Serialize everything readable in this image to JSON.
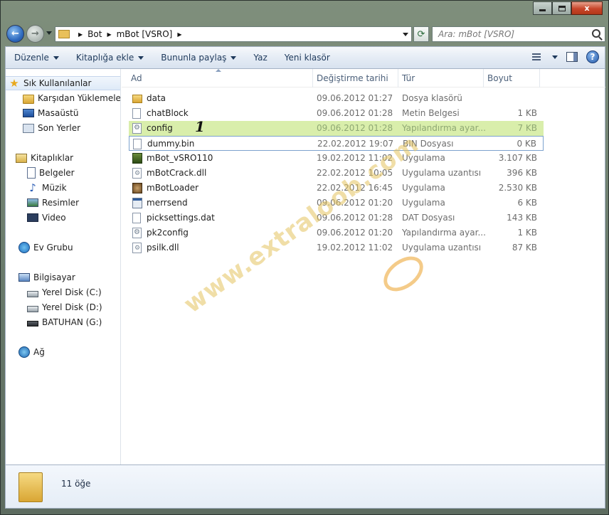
{
  "window": {
    "caption": {
      "close_glyph": "x"
    }
  },
  "address": {
    "crumbs": [
      "Bot",
      "mBot [VSRO]"
    ]
  },
  "search": {
    "placeholder": "Ara: mBot [VSRO]"
  },
  "commands": {
    "organize": "Düzenle",
    "add_to_library": "Kitaplığa ekle",
    "share_with": "Bununla paylaş",
    "burn": "Yaz",
    "new_folder": "Yeni klasör"
  },
  "sidebar": {
    "favorites": {
      "label": "Sık Kullanılanlar",
      "items": [
        "Karşıdan Yüklemeler",
        "Masaüstü",
        "Son Yerler"
      ]
    },
    "libraries": {
      "label": "Kitaplıklar",
      "items": [
        "Belgeler",
        "Müzik",
        "Resimler",
        "Video"
      ]
    },
    "homegroup": {
      "label": "Ev Grubu"
    },
    "computer": {
      "label": "Bilgisayar",
      "items": [
        "Yerel Disk (C:)",
        "Yerel Disk (D:)",
        "BATUHAN (G:)"
      ]
    },
    "network": {
      "label": "Ağ"
    }
  },
  "columns": {
    "name": "Ad",
    "date": "Değiştirme tarihi",
    "type": "Tür",
    "size": "Boyut"
  },
  "files": [
    {
      "name": "data",
      "date": "09.06.2012 01:27",
      "type": "Dosya klasörü",
      "size": "",
      "icon": "folder-icon"
    },
    {
      "name": "chatBlock",
      "date": "09.06.2012 01:28",
      "type": "Metin Belgesi",
      "size": "1 KB",
      "icon": "text-file-icon"
    },
    {
      "name": "config",
      "date": "09.06.2012 01:28",
      "type": "Yapılandırma ayar...",
      "size": "7 KB",
      "icon": "config-file-icon"
    },
    {
      "name": "dummy.bin",
      "date": "22.02.2012 19:07",
      "type": "BIN Dosyası",
      "size": "0 KB",
      "icon": "blank-file-icon"
    },
    {
      "name": "mBot_vSRO110",
      "date": "19.02.2012 11:02",
      "type": "Uygulama",
      "size": "3.107 KB",
      "icon": "mbot-app-icon"
    },
    {
      "name": "mBotCrack.dll",
      "date": "22.02.2012 10:05",
      "type": "Uygulama uzantısı",
      "size": "396 KB",
      "icon": "dll-file-icon"
    },
    {
      "name": "mBotLoader",
      "date": "22.02.2012 16:45",
      "type": "Uygulama",
      "size": "2.530 KB",
      "icon": "loader-app-icon"
    },
    {
      "name": "merrsend",
      "date": "09.06.2012 01:20",
      "type": "Uygulama",
      "size": "6 KB",
      "icon": "app-icon"
    },
    {
      "name": "picksettings.dat",
      "date": "09.06.2012 01:28",
      "type": "DAT Dosyası",
      "size": "143 KB",
      "icon": "blank-file-icon"
    },
    {
      "name": "pk2config",
      "date": "09.06.2012 01:20",
      "type": "Yapılandırma ayar...",
      "size": "1 KB",
      "icon": "config-file-icon"
    },
    {
      "name": "psilk.dll",
      "date": "19.02.2012 11:02",
      "type": "Uygulama uzantısı",
      "size": "87 KB",
      "icon": "dll-file-icon"
    }
  ],
  "annotation": {
    "step": "1"
  },
  "watermark": {
    "text": "www.extraloob.com"
  },
  "details": {
    "count": "11 öğe"
  },
  "colors": {
    "highlight_row": "#d9eeab",
    "command_text": "#1e395b"
  }
}
